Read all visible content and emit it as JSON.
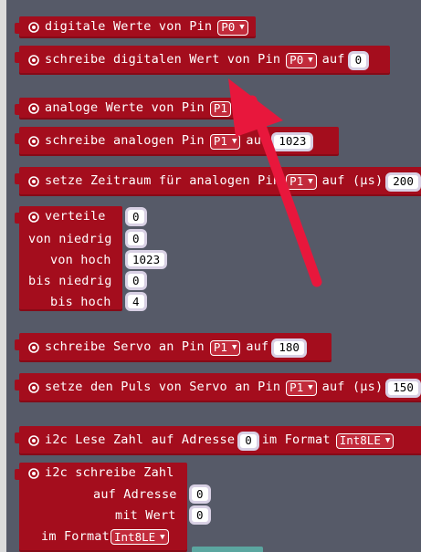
{
  "blocks": {
    "digital_read": {
      "label": "digitale Werte von Pin",
      "pin": "P0"
    },
    "digital_write": {
      "label": "schreibe digitalen Wert von Pin",
      "pin": "P0",
      "auf": "auf",
      "value": "0"
    },
    "analog_read": {
      "label": "analoge Werte von Pin",
      "pin": "P1"
    },
    "analog_write": {
      "label": "schreibe analogen Pin",
      "pin": "P1",
      "auf": "auf",
      "value": "1023"
    },
    "analog_period": {
      "label": "setze Zeitraum für analogen Pin",
      "pin": "P1",
      "auf": "auf (µs)",
      "value": "200"
    },
    "map": {
      "label": "verteile",
      "value": "0",
      "from_low_label": "von niedrig",
      "from_low": "0",
      "from_high_label": "von hoch",
      "from_high": "1023",
      "to_low_label": "bis niedrig",
      "to_low": "0",
      "to_high_label": "bis hoch",
      "to_high": "4"
    },
    "servo_write": {
      "label": "schreibe Servo an Pin",
      "pin": "P1",
      "auf": "auf",
      "value": "180"
    },
    "servo_pulse": {
      "label": "setze den Puls von Servo an Pin",
      "pin": "P1",
      "auf": "auf (µs)",
      "value": "150"
    },
    "i2c_read": {
      "label": "i2c Lese Zahl auf Adresse",
      "address": "0",
      "format_label": "im Format",
      "format": "Int8LE"
    },
    "i2c_write": {
      "label": "i2c schreibe Zahl",
      "address_label": "auf Adresse",
      "address": "0",
      "value_label": "mit Wert",
      "value": "0",
      "format_label": "im Format",
      "format": "Int8LE"
    }
  },
  "icons": {
    "block_icon": "gear-icon",
    "dropdown_arrow": "triangle-down-icon"
  },
  "colors": {
    "workspace": "#565a68",
    "block": "#a40d1d",
    "arrow": "#e8173c"
  }
}
